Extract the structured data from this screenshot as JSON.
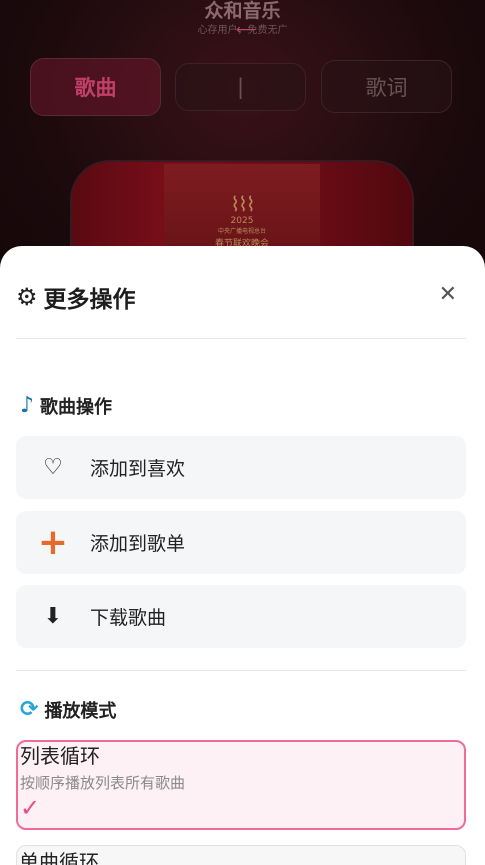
{
  "player": {
    "app_title": "众和音乐",
    "app_subtitle": "心存用户，免费无广",
    "tabs": [
      "歌曲",
      "|",
      "歌词"
    ],
    "cover_text": "春节联欢晚会",
    "cover_year": "2025",
    "cover_org": "中央广播电视总台"
  },
  "sheet": {
    "title": "更多操作",
    "close": "✕",
    "song_section": {
      "title": "歌曲操作",
      "icon": "music-note-icon",
      "actions": [
        {
          "label": "添加到喜欢",
          "icon": "heart-icon",
          "glyph": "♡"
        },
        {
          "label": "添加到歌单",
          "icon": "plus-icon",
          "glyph": "+"
        },
        {
          "label": "下载歌曲",
          "icon": "download-icon",
          "glyph": "⬇"
        }
      ]
    },
    "mode_section": {
      "title": "播放模式",
      "icon": "cycle-icon",
      "modes": [
        {
          "name": "列表循环",
          "desc": "按顺序播放列表所有歌曲",
          "selected": true,
          "check": "✓"
        },
        {
          "name": "单曲循环",
          "selected": false
        }
      ]
    }
  },
  "colors": {
    "accent": "#f04a86",
    "orange": "#e86a2a",
    "blue": "#1673a8"
  }
}
